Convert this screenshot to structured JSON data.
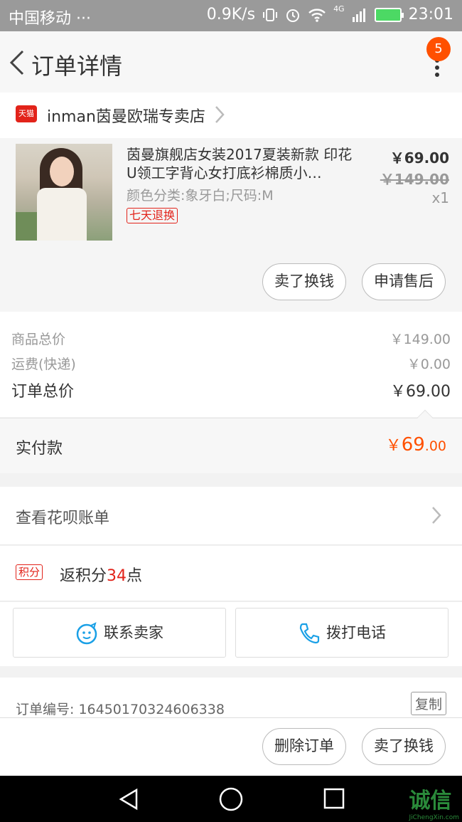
{
  "status_bar": {
    "carrier": "中国移动 ···",
    "speed": "0.9K/s",
    "network": "4G",
    "time": "23:01"
  },
  "nav": {
    "title": "订单详情",
    "badge_count": "5"
  },
  "store": {
    "badge": "天猫",
    "name": "inman茵曼欧瑞专卖店"
  },
  "product": {
    "title": "茵曼旗舰店女装2017夏装新款 印花U领工字背心女打底衫棉质小…",
    "sku": "颜色分类:象牙白;尺码:M",
    "tag": "七天退换",
    "price": "￥69.00",
    "original_price": "￥149.00",
    "quantity": "x1",
    "btn_sell": "卖了换钱",
    "btn_after_sale": "申请售后"
  },
  "summary": {
    "goods_total_label": "商品总价",
    "goods_total_value": "￥149.00",
    "shipping_label": "运费(快递)",
    "shipping_value": "￥0.00",
    "order_total_label": "订单总价",
    "order_total_value": "￥69.00"
  },
  "paid": {
    "label": "实付款",
    "currency": "￥",
    "integer": "69",
    "decimal": ".00"
  },
  "huabei": {
    "label": "查看花呗账单"
  },
  "points": {
    "tag": "积分",
    "prefix": "返积分",
    "number": "34",
    "suffix": "点"
  },
  "contact": {
    "seller": "联系卖家",
    "call": "拨打电话"
  },
  "order": {
    "number_label": "订单编号: 16450170324606338",
    "copy": "复制"
  },
  "actions": {
    "delete": "删除订单",
    "sell": "卖了换钱"
  },
  "watermark": {
    "text": "诚信",
    "sub": "JiChengXin.com"
  },
  "colors": {
    "accent": "#ff5000",
    "tmall_red": "#e2231a",
    "link_blue": "#1aa0e6"
  }
}
